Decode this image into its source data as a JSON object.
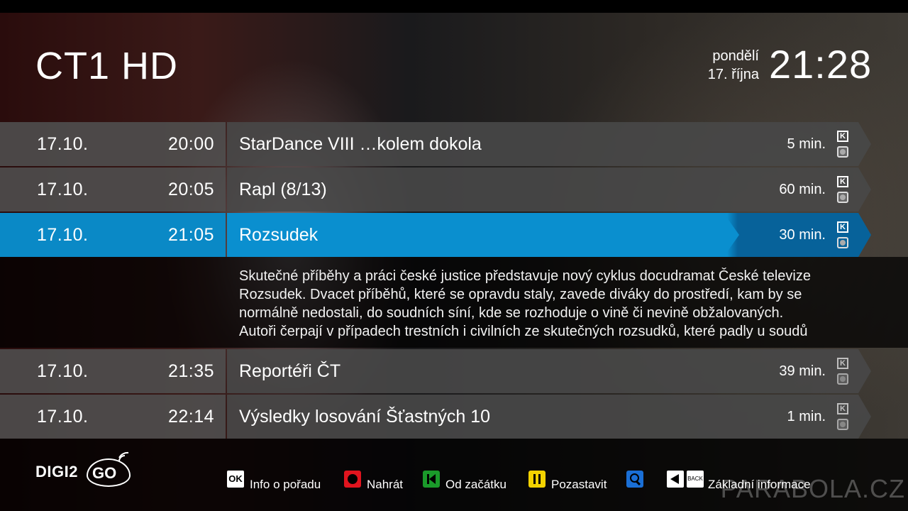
{
  "header": {
    "channel": "CT1 HD",
    "day": "pondělí",
    "date": "17. října",
    "clock": "21:28"
  },
  "epg": [
    {
      "date": "17.10.",
      "time": "20:00",
      "title": "StarDance VIII …kolem dokola",
      "duration": "5 min.",
      "state": "normal"
    },
    {
      "date": "17.10.",
      "time": "20:05",
      "title": "Rapl (8/13)",
      "duration": "60 min.",
      "state": "normal"
    },
    {
      "date": "17.10.",
      "time": "21:05",
      "title": "Rozsudek",
      "duration": "30 min.",
      "state": "active"
    },
    {
      "date": "17.10.",
      "time": "21:35",
      "title": "Reportéři ČT",
      "duration": "39 min.",
      "state": "future"
    },
    {
      "date": "17.10.",
      "time": "22:14",
      "title": "Výsledky losování Šťastných 10",
      "duration": "1 min.",
      "state": "future"
    }
  ],
  "description": {
    "lines": [
      "Skutečné příběhy a práci české justice představuje nový cyklus docudramat České televize",
      "Rozsudek. Dvacet příběhů, které se opravdu staly, zavede diváky do prostředí, kam by se",
      "normálně nedostali, do soudních síní, kde se rozhoduje o vině či nevině obžalovaných.",
      "Autoři čerpají v případech trestních i civilních ze skutečných rozsudků, které padly u soudů"
    ]
  },
  "icons": {
    "k_glyph": "K",
    "ok_glyph": "OK",
    "back_glyph": "BACK"
  },
  "footer": {
    "logo": "DIGI2GO",
    "logo_digi": "DIGI2",
    "logo_go": "GO",
    "hints": {
      "info": "Info o pořadu",
      "record": "Nahrát",
      "restart": "Od začátku",
      "pause": "Pozastavit",
      "basic_info": "Základní informace"
    }
  },
  "colors": {
    "accent": "#0a8fcf",
    "red": "#e0141e",
    "green": "#1a9a2a",
    "yellow": "#f2d200",
    "blue": "#1a6fd6"
  },
  "watermark": "PARABOLA.CZ"
}
